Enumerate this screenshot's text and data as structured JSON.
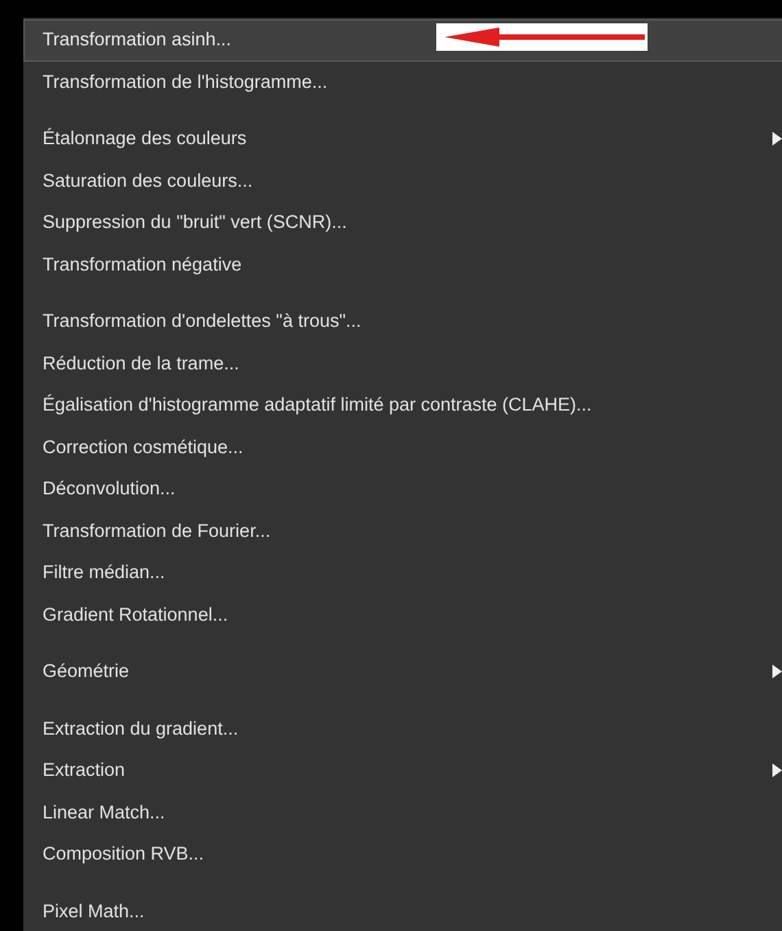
{
  "menu": {
    "items": [
      {
        "kind": "item",
        "label": "Transformation asinh...",
        "selected": true,
        "submenu": false
      },
      {
        "kind": "item",
        "label": "Transformation de l'histogramme...",
        "selected": false,
        "submenu": false
      },
      {
        "kind": "separator"
      },
      {
        "kind": "item",
        "label": "Étalonnage des couleurs",
        "selected": false,
        "submenu": true
      },
      {
        "kind": "item",
        "label": "Saturation des couleurs...",
        "selected": false,
        "submenu": false
      },
      {
        "kind": "item",
        "label": "Suppression du \"bruit\" vert (SCNR)...",
        "selected": false,
        "submenu": false
      },
      {
        "kind": "item",
        "label": "Transformation négative",
        "selected": false,
        "submenu": false
      },
      {
        "kind": "separator"
      },
      {
        "kind": "item",
        "label": "Transformation d'ondelettes \"à trous\"...",
        "selected": false,
        "submenu": false
      },
      {
        "kind": "item",
        "label": "Réduction de la trame...",
        "selected": false,
        "submenu": false
      },
      {
        "kind": "item",
        "label": "Égalisation d'histogramme adaptatif limité par contraste (CLAHE)...",
        "selected": false,
        "submenu": false
      },
      {
        "kind": "item",
        "label": "Correction cosmétique...",
        "selected": false,
        "submenu": false
      },
      {
        "kind": "item",
        "label": "Déconvolution...",
        "selected": false,
        "submenu": false
      },
      {
        "kind": "item",
        "label": "Transformation de Fourier...",
        "selected": false,
        "submenu": false
      },
      {
        "kind": "item",
        "label": "Filtre médian...",
        "selected": false,
        "submenu": false
      },
      {
        "kind": "item",
        "label": "Gradient Rotationnel...",
        "selected": false,
        "submenu": false
      },
      {
        "kind": "separator"
      },
      {
        "kind": "item",
        "label": "Géométrie",
        "selected": false,
        "submenu": true
      },
      {
        "kind": "separator"
      },
      {
        "kind": "item",
        "label": "Extraction du gradient...",
        "selected": false,
        "submenu": false
      },
      {
        "kind": "item",
        "label": "Extraction",
        "selected": false,
        "submenu": true
      },
      {
        "kind": "item",
        "label": "Linear Match...",
        "selected": false,
        "submenu": false
      },
      {
        "kind": "item",
        "label": "Composition RVB...",
        "selected": false,
        "submenu": false
      },
      {
        "kind": "separator"
      },
      {
        "kind": "item",
        "label": "Pixel Math...",
        "selected": false,
        "submenu": false
      }
    ]
  }
}
